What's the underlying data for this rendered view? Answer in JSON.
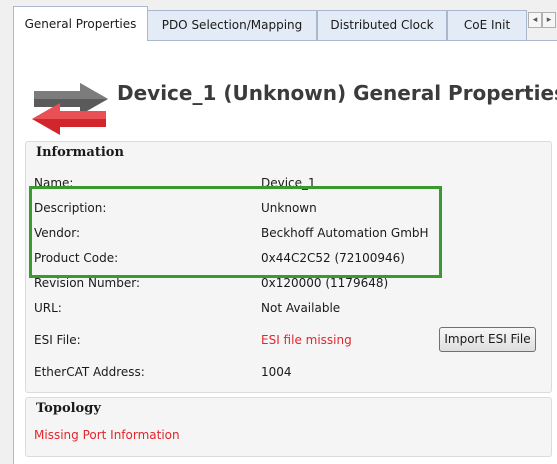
{
  "tabs": [
    {
      "label": "General Properties",
      "active": true
    },
    {
      "label": "PDO Selection/Mapping",
      "active": false
    },
    {
      "label": "Distributed Clock",
      "active": false
    },
    {
      "label": "CoE Init",
      "active": false
    }
  ],
  "tab_scroll": {
    "left": "◂",
    "right": "▸"
  },
  "header": {
    "title": "Device_1 (Unknown) General Properties",
    "icon": "transfer-arrows-icon"
  },
  "information": {
    "title": "Information",
    "rows": [
      {
        "label": "Name:",
        "value": "Device_1"
      },
      {
        "label": "Description:",
        "value": "Unknown"
      },
      {
        "label": "Vendor:",
        "value": "Beckhoff Automation GmbH"
      },
      {
        "label": "Product Code:",
        "value": "0x44C2C52 (72100946)"
      },
      {
        "label": "Revision Number:",
        "value": "0x120000 (1179648)"
      },
      {
        "label": "URL:",
        "value": "Not Available"
      },
      {
        "label": "ESI File:",
        "value": "ESI file missing"
      },
      {
        "label": "EtherCAT Address:",
        "value": "1004"
      }
    ],
    "import_button": "Import ESI File"
  },
  "topology": {
    "title": "Topology",
    "message": "Missing Port Information"
  },
  "colors": {
    "accent_red": "#e3262b",
    "highlight_green": "#3a9a2e",
    "tab_border": "#a9b8cc"
  }
}
